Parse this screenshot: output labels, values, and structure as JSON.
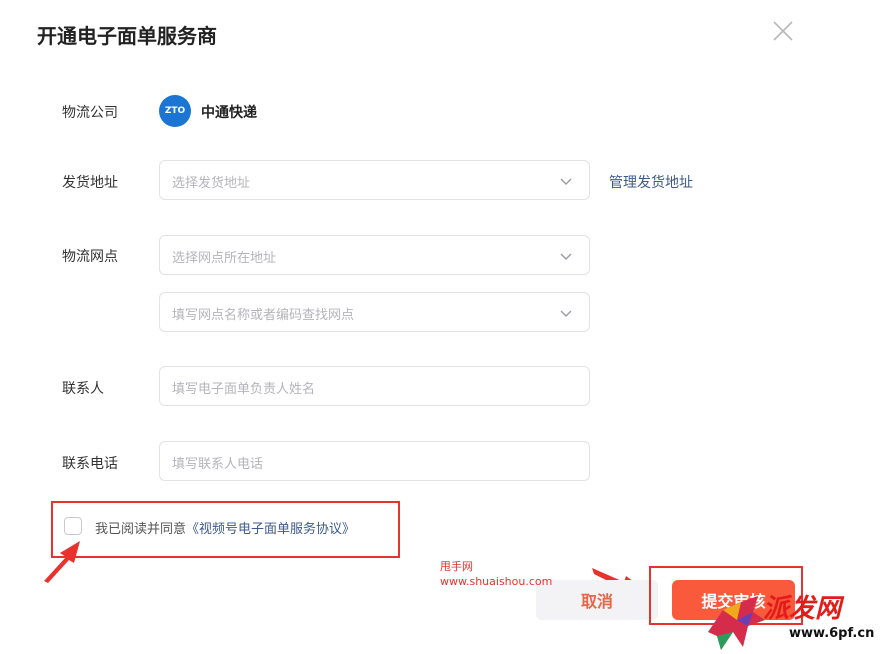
{
  "dialog": {
    "title": "开通电子面单服务商"
  },
  "form": {
    "company": {
      "label": "物流公司",
      "logo_text": "ZTO",
      "name": "中通快递"
    },
    "address": {
      "label": "发货地址",
      "placeholder": "选择发货地址",
      "link": "管理发货地址"
    },
    "network": {
      "label": "物流网点",
      "placeholder_region": "选择网点所在地址",
      "placeholder_search": "填写网点名称或者编码查找网点"
    },
    "contact": {
      "label": "联系人",
      "placeholder": "填写电子面单负责人姓名"
    },
    "phone": {
      "label": "联系电话",
      "placeholder": "填写联系人电话"
    }
  },
  "agreement": {
    "text": "我已阅读并同意",
    "link": "《视频号电子面单服务协议》",
    "checked": false
  },
  "buttons": {
    "cancel": "取消",
    "submit": "提交审核"
  },
  "watermarks": {
    "site_name": "甩手网",
    "site_url": "www.shuaishou.com",
    "brand": "派发网",
    "brand_url": "www.6pf.cn"
  },
  "colors": {
    "accent": "#fa5a3c",
    "link": "#3d5a8a",
    "annotation": "#e8322d",
    "zto_blue": "#1a76d2"
  }
}
